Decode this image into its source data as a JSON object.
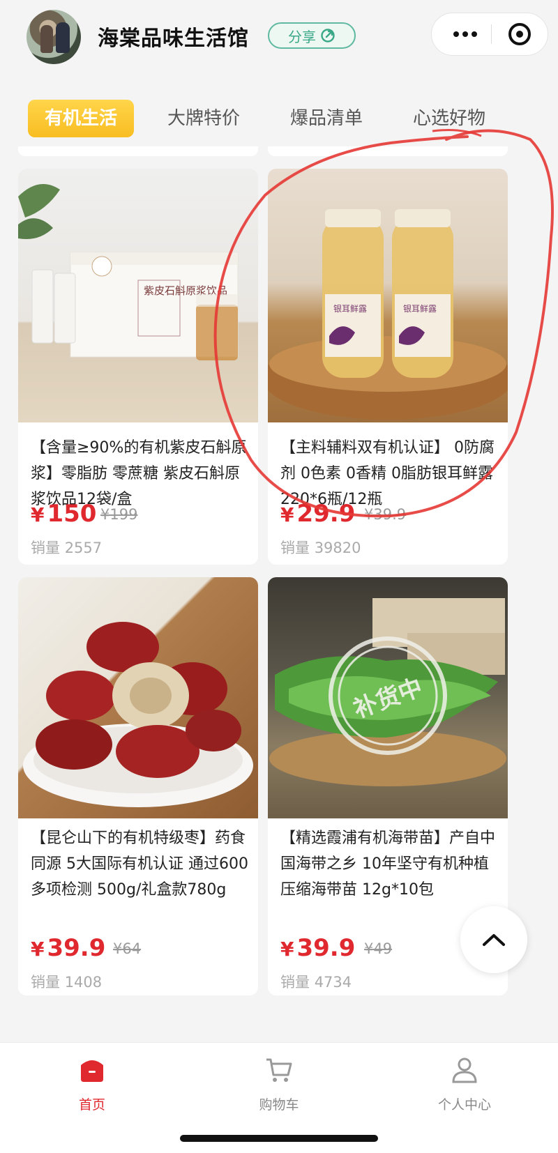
{
  "header": {
    "shop_name": "海棠品味生活馆",
    "share_label": "分享",
    "more_icon": "more-dots-icon",
    "close_icon": "target-icon"
  },
  "tabs": [
    {
      "label": "有机生活",
      "active": true
    },
    {
      "label": "大牌特价",
      "active": false
    },
    {
      "label": "爆品清单",
      "active": false
    },
    {
      "label": "心选好物",
      "active": false
    }
  ],
  "products": [
    {
      "title": "【含量≥90%的有机紫皮石斛原浆】零脂肪 零蔗糖 紫皮石斛原浆饮品12袋/盒",
      "price": "150",
      "currency": "¥",
      "original_price": "¥199",
      "sales_label": "销量",
      "sales": "2557",
      "box_label": "紫皮石斛原浆饮品"
    },
    {
      "title": "【主料辅料双有机认证】 0防腐剂 0色素 0香精 0脂肪银耳鲜露220*6瓶/12瓶",
      "price": "29.9",
      "currency": "¥",
      "original_price": "¥39.9",
      "sales_label": "销量",
      "sales": "39820",
      "bottle_label": "银耳鲜露"
    },
    {
      "title": "【昆仑山下的有机特级枣】药食同源 5大国际有机认证 通过600多项检测 500g/礼盒款780g",
      "price": "39.9",
      "currency": "¥",
      "original_price": "¥64",
      "sales_label": "销量",
      "sales": "1408"
    },
    {
      "title": "【精选霞浦有机海带苗】产自中国海带之乡 10年坚守有机种植 压缩海带苗 12g*10包",
      "price": "39.9",
      "currency": "¥",
      "original_price": "¥49",
      "sales_label": "销量",
      "sales": "4734",
      "stamp": "补货中"
    }
  ],
  "nav": [
    {
      "label": "首页",
      "icon": "home-icon",
      "active": true
    },
    {
      "label": "购物车",
      "icon": "cart-icon",
      "active": false
    },
    {
      "label": "个人中心",
      "icon": "user-icon",
      "active": false
    }
  ],
  "colors": {
    "accent": "#e0282f",
    "tab_active": "#f8bd22",
    "share": "#3aa887",
    "annotation": "#e53935"
  }
}
